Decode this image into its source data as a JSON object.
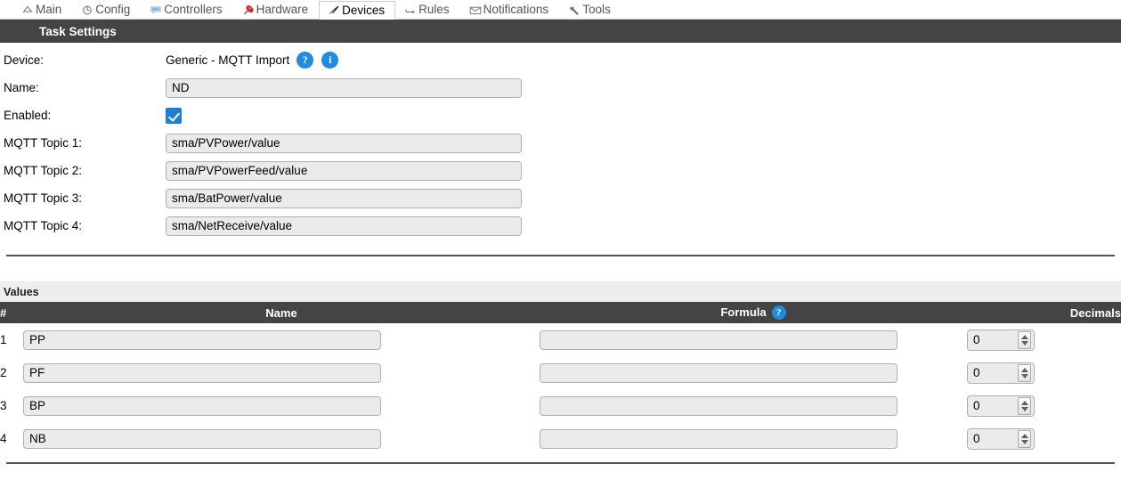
{
  "nav": {
    "tabs": [
      {
        "label": "Main",
        "icon": "home-icon",
        "active": false
      },
      {
        "label": "Config",
        "icon": "gear-icon",
        "active": false
      },
      {
        "label": "Controllers",
        "icon": "chat-icon",
        "active": false
      },
      {
        "label": "Hardware",
        "icon": "pushpin-icon",
        "active": false
      },
      {
        "label": "Devices",
        "icon": "plug-icon",
        "active": true
      },
      {
        "label": "Rules",
        "icon": "arrow-icon",
        "active": false
      },
      {
        "label": "Notifications",
        "icon": "envelope-icon",
        "active": false
      },
      {
        "label": "Tools",
        "icon": "wrench-icon",
        "active": false
      }
    ]
  },
  "task_settings": {
    "header": "Task Settings",
    "device": {
      "label": "Device:",
      "value": "Generic - MQTT Import",
      "help_icon": "?",
      "info_icon": "i"
    },
    "name": {
      "label": "Name:",
      "value": "ND",
      "placeholder": ""
    },
    "enabled": {
      "label": "Enabled:",
      "checked": true
    },
    "topics": [
      {
        "label": "MQTT Topic 1:",
        "value": "sma/PVPower/value"
      },
      {
        "label": "MQTT Topic 2:",
        "value": "sma/PVPowerFeed/value"
      },
      {
        "label": "MQTT Topic 3:",
        "value": "sma/BatPower/value"
      },
      {
        "label": "MQTT Topic 4:",
        "value": "sma/NetReceive/value"
      }
    ]
  },
  "values": {
    "section_label": "Values",
    "columns": {
      "num": "#",
      "name": "Name",
      "formula": "Formula",
      "formula_help": "?",
      "decimals": "Decimals"
    },
    "rows": [
      {
        "num": "1",
        "name": "PP",
        "formula": "",
        "decimals": "0"
      },
      {
        "num": "2",
        "name": "PF",
        "formula": "",
        "decimals": "0"
      },
      {
        "num": "3",
        "name": "BP",
        "formula": "",
        "decimals": "0"
      },
      {
        "num": "4",
        "name": "NB",
        "formula": "",
        "decimals": "0"
      }
    ]
  },
  "colors": {
    "header_bar": "#444444",
    "accent_blue": "#1e8ce0",
    "checkbox_blue": "#1b7fd4",
    "values_bar": "#eeeeee",
    "input_bg": "#ebebeb"
  }
}
